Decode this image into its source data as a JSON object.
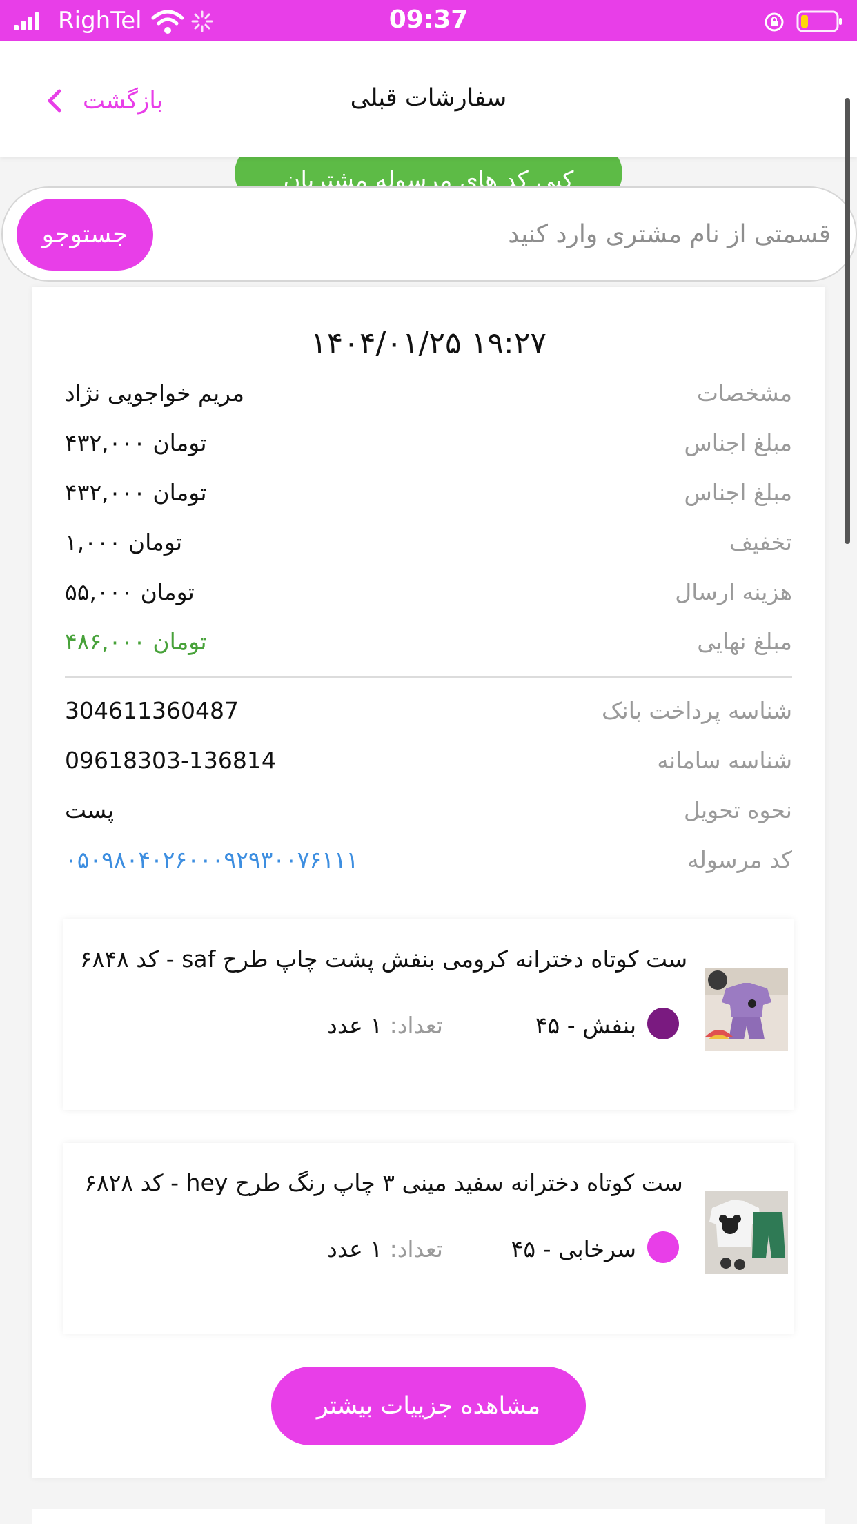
{
  "status_bar": {
    "carrier": "RighTel",
    "time": "09:37"
  },
  "header": {
    "back_label": "بازگشت",
    "title": "سفارشات قبلی"
  },
  "copy_button": {
    "label": "کپی کد های مرسوله مشتریان"
  },
  "search": {
    "placeholder": "قسمتی از نام مشتری وارد کنید",
    "value": "",
    "button_label": "جستوجو"
  },
  "order": {
    "datetime": "۱۴۰۴/۰۱/۲۵ ۱۹:۲۷",
    "rows": [
      {
        "label": "مشخصات",
        "value": "مریم خواجویی نژاد"
      },
      {
        "label": "مبلغ اجناس",
        "value": "۴۳۲,۰۰۰ تومان"
      },
      {
        "label": "مبلغ اجناس",
        "value": "۴۳۲,۰۰۰ تومان"
      },
      {
        "label": "تخفیف",
        "value": "۱,۰۰۰ تومان"
      },
      {
        "label": "هزینه ارسال",
        "value": "۵۵,۰۰۰ تومان"
      },
      {
        "label": "مبلغ نهایی",
        "value": "۴۸۶,۰۰۰ تومان"
      }
    ],
    "info_rows": [
      {
        "label": "شناسه پرداخت بانک",
        "value": "304611360487"
      },
      {
        "label": "شناسه سامانه",
        "value": "09618303-136814"
      },
      {
        "label": "نحوه تحویل",
        "value": "پست"
      },
      {
        "label": "کد مرسوله",
        "value": "۰۵۰۹۸۰۴۰۲۶۰۰۰۹۲۹۳۰۰۷۶۱۱۱"
      }
    ],
    "items": [
      {
        "title": "ست کوتاه دخترانه کرومی بنفش پشت چاپ طرح saf - کد ۶۸۴۸",
        "color_name": "بنفش  - ۴۵",
        "color_hex": "#7a1a80",
        "qty_label": "تعداد:",
        "qty_value": " ۱ عدد"
      },
      {
        "title": "ست کوتاه دخترانه سفید مینی ۳ چاپ رنگ طرح hey - کد ۶۸۲۸",
        "color_name": "سرخابی  - ۴۵",
        "color_hex": "#e83ee8",
        "qty_label": "تعداد:",
        "qty_value": " ۱ عدد"
      }
    ],
    "details_button": "مشاهده جزییات بیشتر"
  },
  "colors": {
    "accent": "#e83ee8",
    "success": "#48a23a",
    "link": "#3d8ee0",
    "copy_button": "#5dbb46"
  }
}
